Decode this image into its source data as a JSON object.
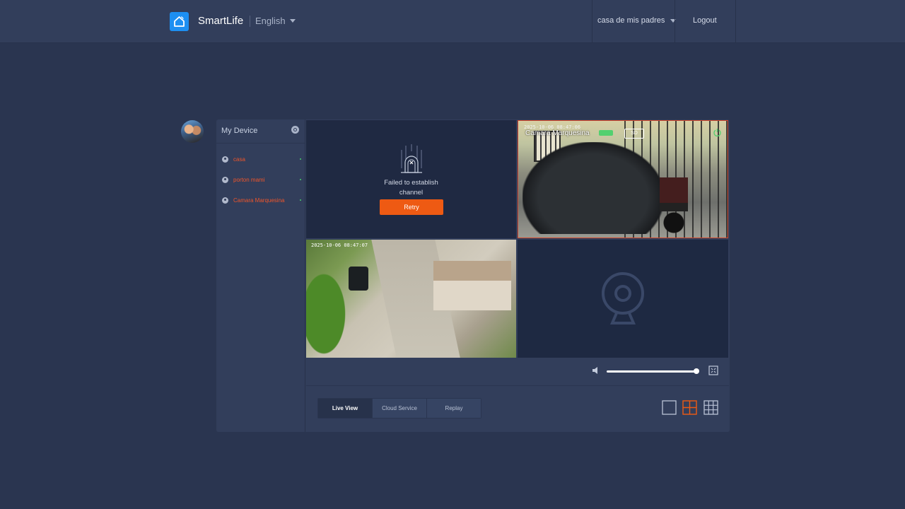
{
  "header": {
    "brand": "SmartLife",
    "language": "English",
    "home": "casa de mis padres",
    "logout": "Logout"
  },
  "sidebar": {
    "title": "My Device",
    "devices": [
      {
        "label": "casa",
        "status": "online"
      },
      {
        "label": "porton mami",
        "status": "online"
      },
      {
        "label": "Camara Marquesina",
        "status": "online"
      }
    ]
  },
  "grid": {
    "cell1": {
      "message_line1": "Failed to establish",
      "message_line2": "channel",
      "retry_label": "Retry"
    },
    "cell2": {
      "timestamp": "2025-10-06 08:47:06",
      "camera_name": "Camara Marquesina",
      "sd_label": "SD"
    },
    "cell3": {
      "timestamp": "2025-10-06 08:47:07"
    },
    "cell4": {
      "state": "empty"
    }
  },
  "controls": {
    "volume": 0.98,
    "tabs": [
      "Live View",
      "Cloud Service",
      "Replay"
    ],
    "active_tab": "Live View",
    "layouts": [
      "single",
      "quad",
      "nine"
    ],
    "active_layout": "quad"
  },
  "colors": {
    "background": "#2a3550",
    "panel": "#323e5b",
    "accent": "#ee5a13",
    "brand": "#1d8ff2",
    "online": "#48d06b"
  }
}
